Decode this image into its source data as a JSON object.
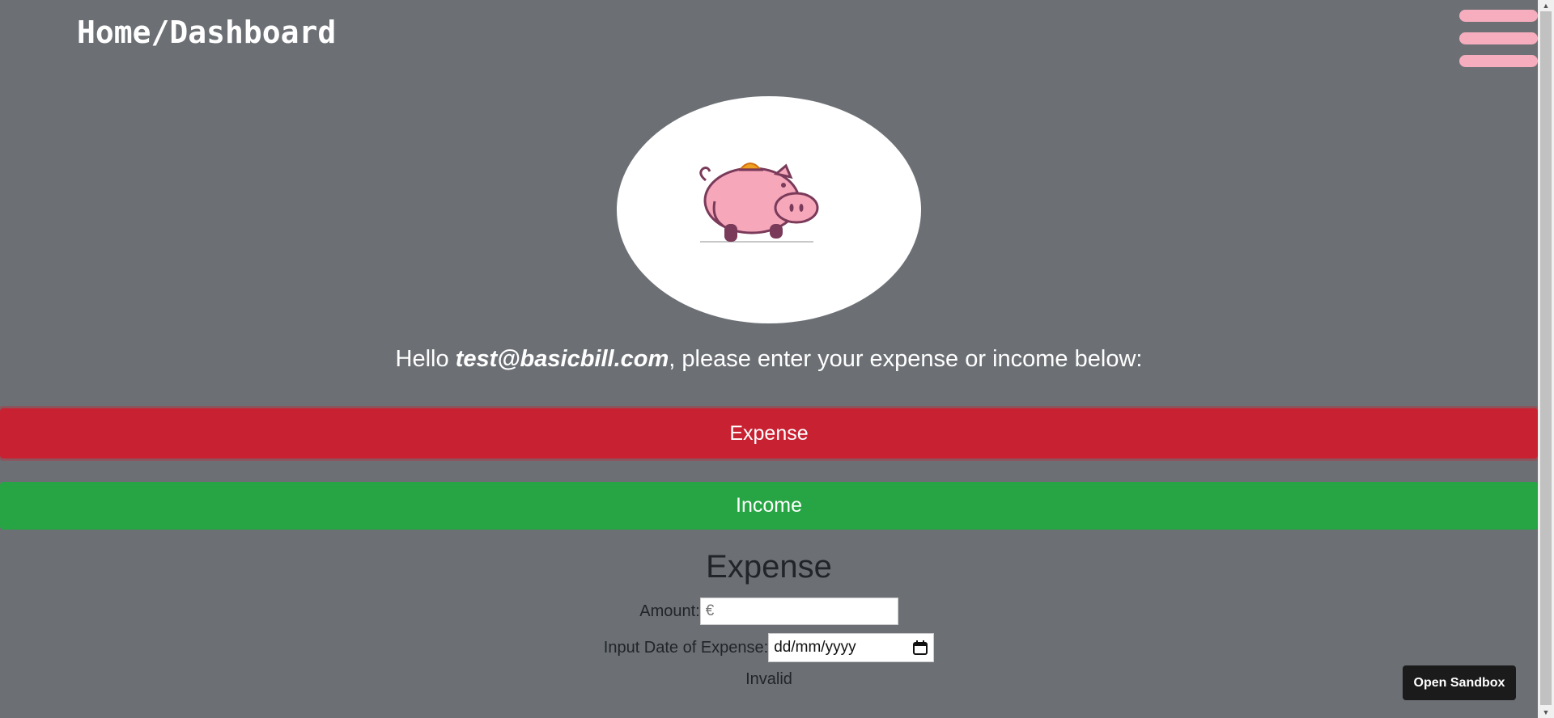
{
  "header": {
    "title": "Home/Dashboard",
    "menu_icon": "hamburger-menu-icon"
  },
  "hero": {
    "image_icon": "piggy-bank-icon"
  },
  "greeting": {
    "prefix": "Hello ",
    "email": "test@basicbill.com",
    "suffix": ", please enter your expense or income below:"
  },
  "buttons": {
    "expense_label": "Expense",
    "income_label": "Income"
  },
  "form": {
    "title": "Expense",
    "amount_label": "Amount:",
    "amount_placeholder": "€",
    "amount_value": "",
    "date_label": "Input Date of Expense:",
    "date_value": "dd/mm/yyyy",
    "date_icon": "calendar-icon",
    "validation_text": "Invalid"
  },
  "sandbox": {
    "label": "Open Sandbox"
  },
  "colors": {
    "background": "#6c7075",
    "expense": "#c82132",
    "income": "#27a544",
    "menu": "#f6adbd"
  }
}
